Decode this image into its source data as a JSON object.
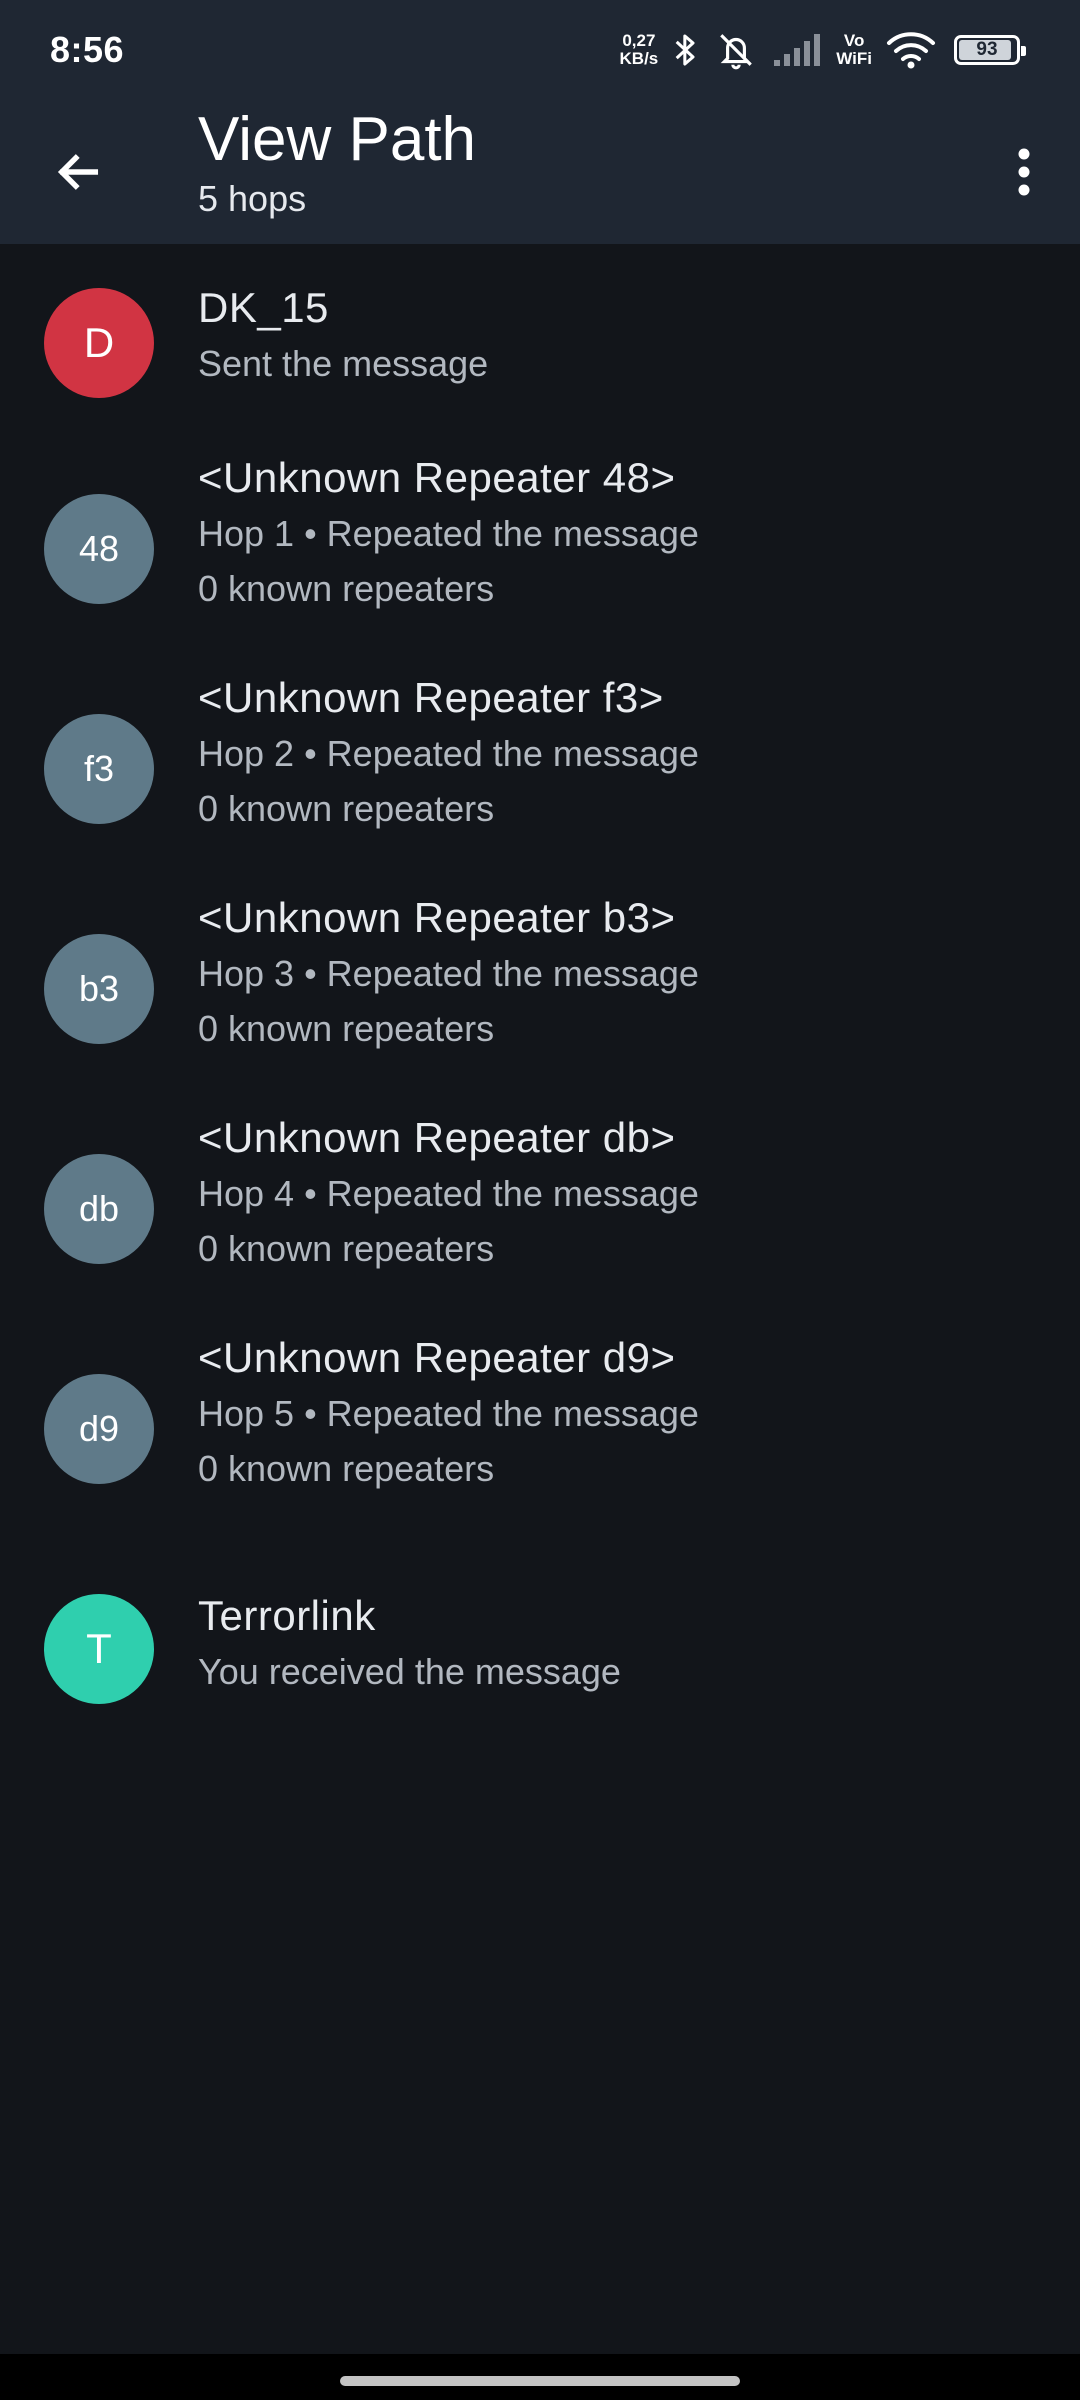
{
  "status_bar": {
    "time": "8:56",
    "net_speed_value": "0,27",
    "net_speed_unit": "KB/s",
    "vowifi_top": "Vo",
    "vowifi_bottom": "WiFi",
    "battery": "93",
    "battery_level_percent": 93
  },
  "app_bar": {
    "title": "View Path",
    "subtitle": "5 hops",
    "back_icon": "arrow-back-icon",
    "menu_icon": "more-vert-icon",
    "background": "#1f2733"
  },
  "hops": [
    {
      "avatar": "D",
      "avatar_color": "#d13443",
      "name": "DK_15",
      "detail": "Sent the message"
    },
    {
      "avatar": "48",
      "avatar_color": "#5f7a89",
      "name": "<Unknown Repeater 48>",
      "detail": "Hop 1 • Repeated the message",
      "repeaters": "0 known repeaters"
    },
    {
      "avatar": "f3",
      "avatar_color": "#5f7a89",
      "name": "<Unknown Repeater f3>",
      "detail": "Hop 2 • Repeated the message",
      "repeaters": "0 known repeaters"
    },
    {
      "avatar": "b3",
      "avatar_color": "#5f7a89",
      "name": "<Unknown Repeater b3>",
      "detail": "Hop 3 • Repeated the message",
      "repeaters": "0 known repeaters"
    },
    {
      "avatar": "db",
      "avatar_color": "#5f7a89",
      "name": "<Unknown Repeater db>",
      "detail": "Hop 4 • Repeated the message",
      "repeaters": "0 known repeaters"
    },
    {
      "avatar": "d9",
      "avatar_color": "#5f7a89",
      "name": "<Unknown Repeater d9>",
      "detail": "Hop 5 • Repeated the message",
      "repeaters": "0 known repeaters"
    },
    {
      "avatar": "T",
      "avatar_color": "#2fcfae",
      "name": "Terrorlink",
      "detail": "You received the message"
    }
  ],
  "colors": {
    "background": "#12151a",
    "primary_text": "#e8ebef",
    "secondary_text": "#b2b8c0"
  }
}
